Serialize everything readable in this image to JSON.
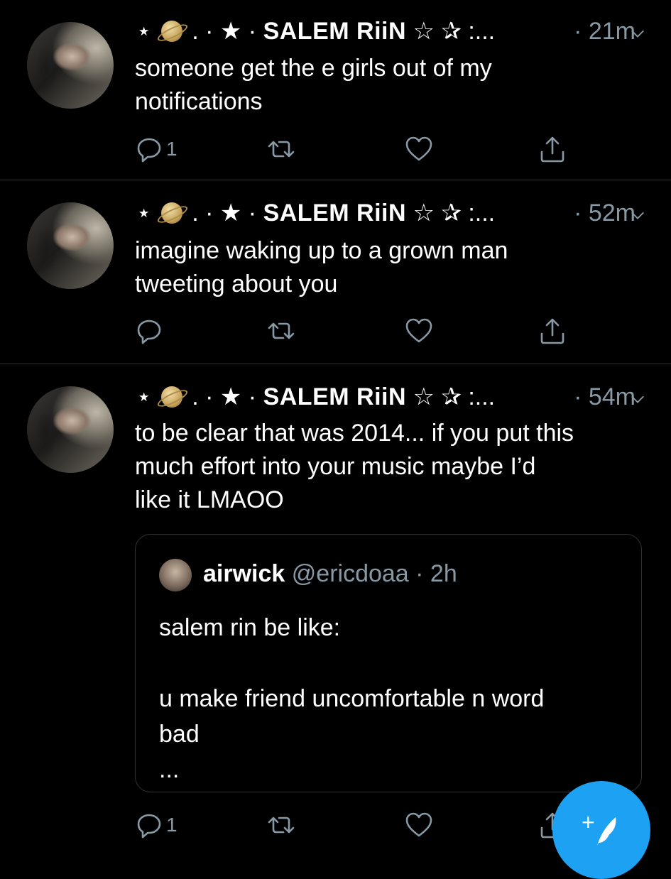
{
  "tweets": [
    {
      "author": {
        "prefix": "⋆",
        "planet": "saturn-emoji",
        "middle": ". · ★ ·",
        "name": "SALEM RiiN",
        "suffix": "☆ ✰ :..."
      },
      "time": "· 21m",
      "text": "someone get the e girls out of my\nnotifications",
      "replies": "1",
      "retweets": "",
      "likes": ""
    },
    {
      "author": {
        "prefix": "⋆",
        "planet": "saturn-emoji",
        "middle": ". · ★ ·",
        "name": "SALEM RiiN",
        "suffix": "☆ ✰ :..."
      },
      "time": "· 52m",
      "text": "imagine waking up to a grown man\ntweeting about you",
      "replies": "",
      "retweets": "",
      "likes": ""
    },
    {
      "author": {
        "prefix": "⋆",
        "planet": "saturn-emoji",
        "middle": ". · ★ ·",
        "name": "SALEM RiiN",
        "suffix": "☆ ✰ :..."
      },
      "time": "· 54m",
      "text": "to be clear that was 2014... if you put this\nmuch effort into your music maybe I’d\nlike it LMAOO",
      "replies": "1",
      "retweets": "",
      "likes": "",
      "quote": {
        "name": "airwick",
        "handle": "@ericdoaa",
        "time": "· 2h",
        "text": "salem rin be like:\n\nu make friend uncomfortable n word\nbad\n..."
      }
    }
  ],
  "fab": {
    "label": "+",
    "icon": "compose-feather-icon",
    "color": "#1da1f2"
  },
  "colors": {
    "background": "#000000",
    "muted": "#8899a6",
    "divider": "#2f3336",
    "accent": "#1da1f2"
  }
}
